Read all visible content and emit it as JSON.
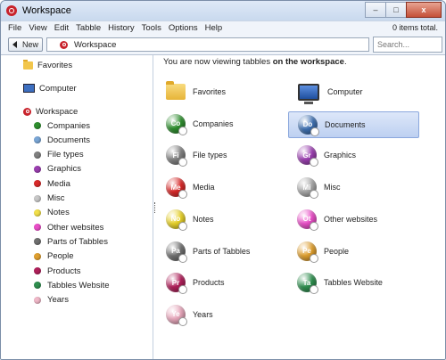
{
  "window": {
    "title": "Workspace",
    "minimize": "–",
    "maximize": "□",
    "close": "x"
  },
  "menu": [
    "File",
    "View",
    "Edit",
    "Tabble",
    "History",
    "Tools",
    "Options",
    "Help"
  ],
  "status": {
    "items_selected": "0 items total."
  },
  "toolbar": {
    "new_label": "New",
    "address": "Workspace",
    "search_placeholder": "Search..."
  },
  "sidebar": {
    "favorites": "Favorites",
    "computer": "Computer",
    "workspace": "Workspace",
    "items": [
      {
        "label": "Companies",
        "color": "#2f8f2f"
      },
      {
        "label": "Documents",
        "color": "#7aa6d6"
      },
      {
        "label": "File types",
        "color": "#808080"
      },
      {
        "label": "Graphics",
        "color": "#9b3fb0"
      },
      {
        "label": "Media",
        "color": "#d92a2a"
      },
      {
        "label": "Misc",
        "color": "#c8c8c8"
      },
      {
        "label": "Notes",
        "color": "#f2e04a"
      },
      {
        "label": "Other websites",
        "color": "#ea4fc8"
      },
      {
        "label": "Parts of Tabbles",
        "color": "#707070"
      },
      {
        "label": "People",
        "color": "#e0a030"
      },
      {
        "label": "Products",
        "color": "#b0205a"
      },
      {
        "label": "Tabbles Website",
        "color": "#2f8f4f"
      },
      {
        "label": "Years",
        "color": "#f0b8c8"
      }
    ]
  },
  "main": {
    "heading_prefix": "You are now viewing tabbles ",
    "heading_bold": "on the workspace",
    "heading_suffix": ".",
    "tiles": [
      {
        "label": "Favorites",
        "kind": "folder"
      },
      {
        "label": "Computer",
        "kind": "computer"
      },
      {
        "label": "Companies",
        "abbr": "Co",
        "color": "#2f8f2f"
      },
      {
        "label": "Documents",
        "abbr": "Do",
        "color": "#3d6fb0",
        "selected": true
      },
      {
        "label": "File types",
        "abbr": "Fi",
        "color": "#808080"
      },
      {
        "label": "Graphics",
        "abbr": "Gr",
        "color": "#9b3fb0"
      },
      {
        "label": "Media",
        "abbr": "Me",
        "color": "#d92a2a"
      },
      {
        "label": "Misc",
        "abbr": "Mi",
        "color": "#a8a8a8"
      },
      {
        "label": "Notes",
        "abbr": "No",
        "color": "#e8d22a"
      },
      {
        "label": "Other websites",
        "abbr": "Ot",
        "color": "#ea4fc8"
      },
      {
        "label": "Parts of Tabbles",
        "abbr": "Pa",
        "color": "#707070"
      },
      {
        "label": "People",
        "abbr": "Pe",
        "color": "#e0a030"
      },
      {
        "label": "Products",
        "abbr": "Pr",
        "color": "#b0205a"
      },
      {
        "label": "Tabbles Website",
        "abbr": "Ta",
        "color": "#2f8f4f"
      },
      {
        "label": "Years",
        "abbr": "Ye",
        "color": "#e8a8bc"
      }
    ]
  }
}
